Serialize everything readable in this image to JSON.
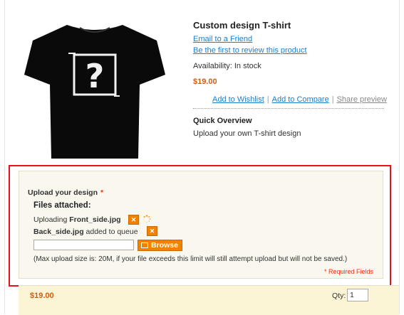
{
  "product": {
    "title": "Custom design T-shirt",
    "email_link": "Email to a Friend",
    "review_link": "Be the first to review this product",
    "availability": "Availability: In stock",
    "price": "$19.00"
  },
  "actions": {
    "wishlist": "Add to Wishlist",
    "compare": "Add to Compare",
    "share": "Share preview",
    "separator": "|"
  },
  "overview": {
    "title": "Quick Overview",
    "text": "Upload your own T-shirt design"
  },
  "options": {
    "upload_label": "Upload your design",
    "required_star": "*",
    "files_attached": "Files attached:",
    "file1_prefix": "Uploading ",
    "file1_name": "Front_side.jpg",
    "file2_name": "Back_side.jpg",
    "file2_suffix": " added to queue",
    "remove_symbol": "✕",
    "browse_label": "Browse",
    "limit_note": "(Max upload size is: 20M, if your file exceeds this limit will still attempt upload but will not be  saved.)",
    "required_note": "* Required Fields"
  },
  "cart": {
    "price": "$19.00",
    "qty_label": "Qty:",
    "qty_value": "1"
  },
  "colors": {
    "link": "#1e7ec8",
    "price": "#d05d10",
    "accent_orange": "#f18200",
    "required_red": "#eb340a",
    "highlight_red": "#e8121b"
  },
  "icons": [
    "tshirt-image",
    "remove-icon",
    "loading-spinner-icon",
    "browse-folder-icon"
  ]
}
